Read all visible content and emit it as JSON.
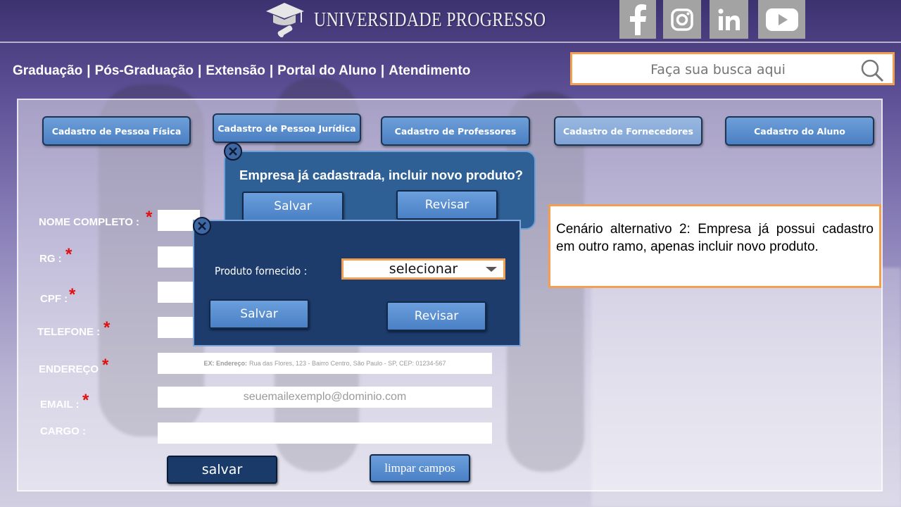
{
  "header": {
    "logo_text": "UNIVERSIDADE PROGRESSO",
    "social": [
      {
        "icon": "facebook-icon"
      },
      {
        "icon": "instagram-icon"
      },
      {
        "icon": "linkedin-icon"
      },
      {
        "icon": "youtube-icon"
      }
    ]
  },
  "nav": {
    "items": [
      "Graduação",
      "Pós-Graduação",
      "Extensão",
      "Portal do Aluno",
      "Atendimento"
    ],
    "separator": "|"
  },
  "search": {
    "placeholder": "Faça sua busca aqui"
  },
  "tabs": [
    {
      "label": "Cadastro de Pessoa Física"
    },
    {
      "label": "Cadastro de Pessoa Jurídica"
    },
    {
      "label": "Cadastro de Professores"
    },
    {
      "label": "Cadastro de  Fornecedores"
    },
    {
      "label": "Cadastro do Aluno"
    }
  ],
  "form": {
    "fields": [
      {
        "label": "NOME COMPLETO :",
        "required": true,
        "placeholder": ""
      },
      {
        "label": "RG :",
        "required": true,
        "placeholder": ""
      },
      {
        "label": "CPF :",
        "required": true,
        "placeholder": ""
      },
      {
        "label": "TELEFONE :",
        "required": true,
        "placeholder": ""
      },
      {
        "label": "ENDEREÇO",
        "required": true,
        "placeholder_bold": "EX: Endereço:",
        "placeholder": "Rua das Flores, 123 - Bairro Centro, São Paulo - SP, CEP: 01234-567"
      },
      {
        "label": "EMAIL :",
        "required": true,
        "placeholder": "seuemailexemplo@dominio.com"
      },
      {
        "label": "CARGO :",
        "required": false,
        "placeholder": ""
      }
    ],
    "required_mark": "*",
    "save_label": "salvar",
    "clear_label": "limpar campos"
  },
  "dialog_confirm": {
    "question": "Empresa já cadastrada, incluir novo produto?",
    "save_label": "Salvar",
    "review_label": "Revisar"
  },
  "dialog_product": {
    "product_label": "Produto fornecido :",
    "select_value": "selecionar",
    "save_label": "Salvar",
    "review_label": "Revisar"
  },
  "note": {
    "text": "Cenário alternativo 2: Empresa já possui cadastro em outro ramo, apenas incluir novo produto."
  },
  "colors": {
    "button_blue": "#4a80c5",
    "dialog_dark": "#1d3c6c",
    "dialog_mid": "#2e5f95",
    "accent_orange": "#f0a050",
    "required_red": "#e01010",
    "save_dark": "#1a3b69"
  }
}
